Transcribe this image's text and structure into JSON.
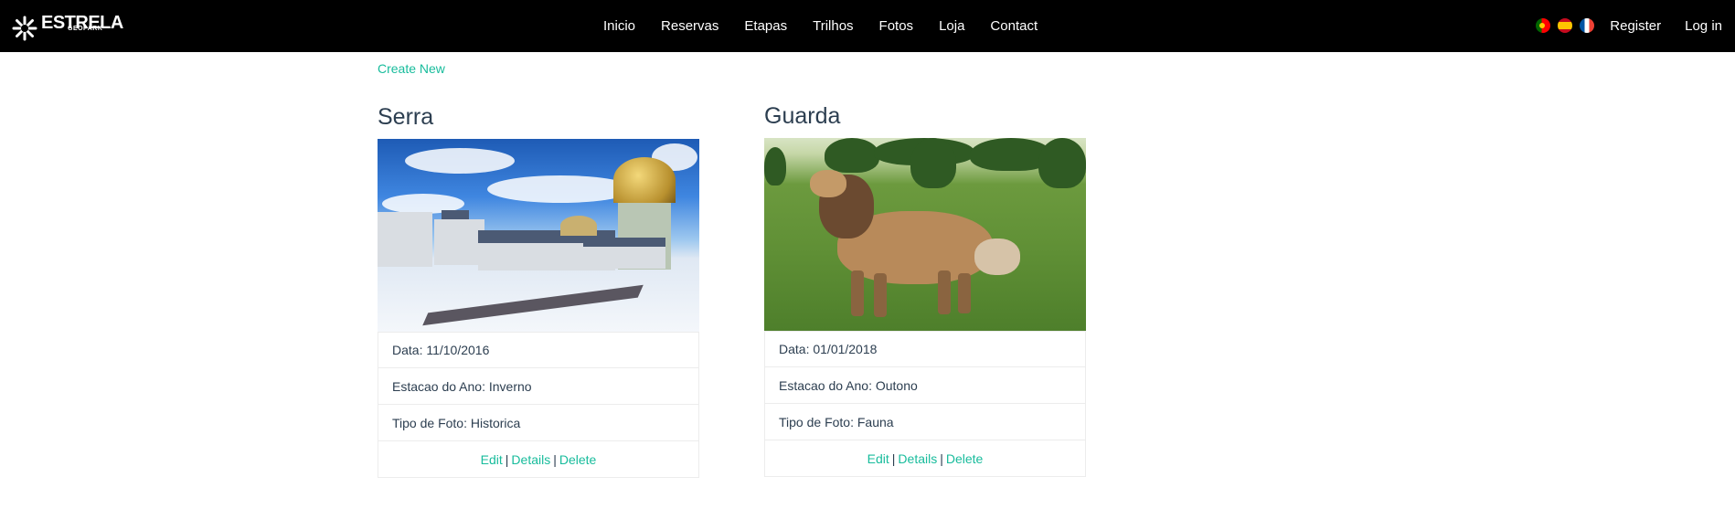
{
  "navbar": {
    "brand": {
      "name": "ESTRELA",
      "sub": "GEOPARK"
    },
    "links": [
      "Inicio",
      "Reservas",
      "Etapas",
      "Trilhos",
      "Fotos",
      "Loja",
      "Contact"
    ],
    "flags": [
      "portugal-flag-icon",
      "spain-flag-icon",
      "france-flag-icon"
    ],
    "auth": {
      "register": "Register",
      "login": "Log in"
    }
  },
  "create_new": "Create New",
  "cards": [
    {
      "title": "Serra",
      "image": "serra-observatory-snow-photo",
      "data": "Data: 11/10/2016",
      "estacao": "Estacao do Ano: Inverno",
      "tipo": "Tipo de Foto: Historica",
      "actions": {
        "edit": "Edit",
        "details": "Details",
        "delete": "Delete",
        "sep": "|"
      }
    },
    {
      "title": "Guarda",
      "image": "guarda-estrela-dog-photo",
      "data": "Data: 01/01/2018",
      "estacao": "Estacao do Ano: Outono",
      "tipo": "Tipo de Foto: Fauna",
      "actions": {
        "edit": "Edit",
        "details": "Details",
        "delete": "Delete",
        "sep": "|"
      }
    }
  ],
  "colors": {
    "navbar": "#000000",
    "link": "#18bc9c",
    "text": "#2c3e50"
  }
}
